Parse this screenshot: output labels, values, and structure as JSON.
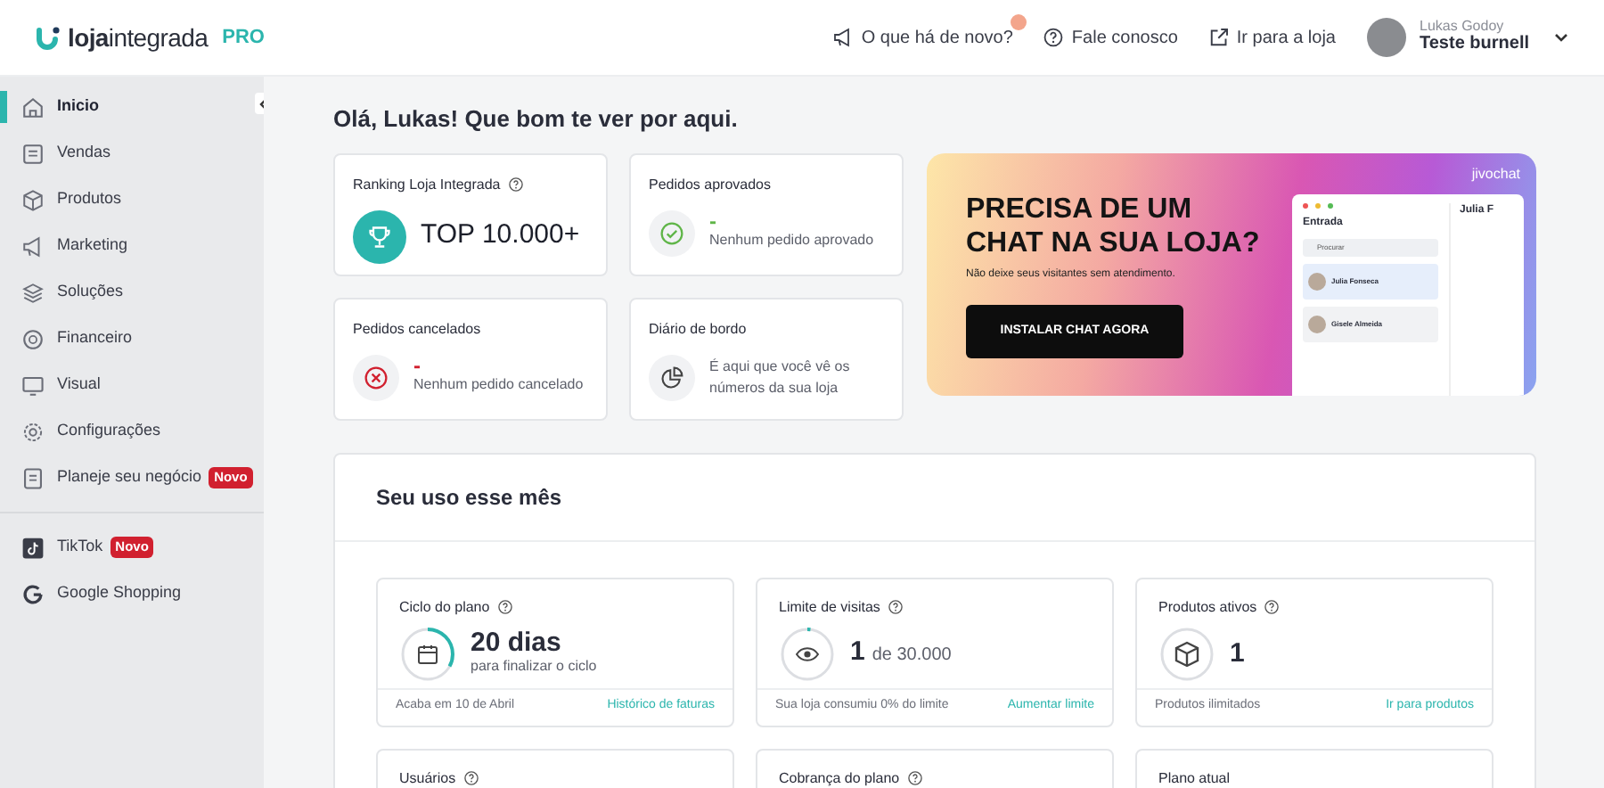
{
  "header": {
    "logo": "**loja**integrada",
    "plan": "PRO",
    "links": [
      {
        "label": "O que há de novo?",
        "kind": "megaphone",
        "notification": true
      },
      {
        "label": "Fale conosco",
        "kind": "help",
        "notification": false
      },
      {
        "label": "Ir para a loja",
        "kind": "external",
        "notification": false
      }
    ],
    "user": {
      "name": "Lukas Godoy",
      "store": "Teste burnell"
    }
  },
  "sidebar": {
    "groups": [
      [
        {
          "label": "Inicio",
          "kind": "home",
          "selected": true
        },
        {
          "label": "Vendas",
          "kind": "receipt",
          "selected": false
        },
        {
          "label": "Produtos",
          "kind": "box",
          "selected": false
        },
        {
          "label": "Marketing",
          "kind": "megaphone",
          "selected": false
        },
        {
          "label": "Soluções",
          "kind": "layers",
          "selected": false
        },
        {
          "label": "Financeiro",
          "kind": "coin",
          "selected": false
        },
        {
          "label": "Visual",
          "kind": "monitor",
          "selected": false
        },
        {
          "label": "Configurações",
          "kind": "gear",
          "selected": false
        },
        {
          "label": "Planeje seu negócio",
          "kind": "doc",
          "selected": false,
          "badge": "Novo"
        }
      ],
      [
        {
          "label": "TikTok",
          "kind": "tiktok",
          "selected": false,
          "badge": "Novo"
        },
        {
          "label": "Google Shopping",
          "kind": "google",
          "selected": false
        }
      ]
    ]
  },
  "greeting": "Olá, Lukas! Que bom te ver por aqui.",
  "summary_cards": [
    {
      "kind": "ranking",
      "title": "Ranking Loja Integrada",
      "help": true,
      "value": "TOP 10.000+"
    },
    {
      "kind": "approved",
      "title": "Pedidos aprovados",
      "help": false,
      "value": "-",
      "note": "Nenhum pedido aprovado"
    },
    {
      "kind": "cancelled",
      "title": "Pedidos cancelados",
      "help": false,
      "value": "-",
      "note": "Nenhum pedido cancelado"
    },
    {
      "kind": "journal",
      "title": "Diário de bordo",
      "help": false,
      "note": "É aqui que você vê os números da sua loja"
    }
  ],
  "banner": {
    "brand": "jivochat",
    "headline": "PRECISA DE UM CHAT NA SUA LOJA?",
    "subtitle": "Não deixe seus visitantes sem atendimento.",
    "button": "INSTALAR CHAT AGORA",
    "app": {
      "title": "Entrada",
      "search": "Procurar",
      "side_title": "Julia F",
      "contacts": [
        "Julia Fonseca",
        "Gisele Almeida"
      ]
    }
  },
  "usage": {
    "title": "Seu uso esse mês",
    "cards": [
      {
        "kind": "cycle",
        "title": "Ciclo do plano",
        "help": true,
        "value": "20 dias",
        "suffix": "para finalizar o ciclo",
        "level": 0.33,
        "footer": "Acaba em 10 de Abril",
        "link": "Histórico de faturas"
      },
      {
        "kind": "visits",
        "title": "Limite de visitas",
        "help": true,
        "value": "1",
        "suffix": "de 30.000",
        "level": 0.02,
        "footer": "Sua loja consumiu 0% do limite",
        "link": "Aumentar limite"
      },
      {
        "kind": "products",
        "title": "Produtos ativos",
        "help": true,
        "value": "1",
        "footer": "Produtos ilimitados",
        "link": "Ir para produtos"
      },
      {
        "kind": "users",
        "title": "Usuários",
        "help": true
      },
      {
        "kind": "billing",
        "title": "Cobrança do plano",
        "help": true
      },
      {
        "kind": "plan",
        "title": "Plano atual",
        "help": false
      }
    ]
  }
}
